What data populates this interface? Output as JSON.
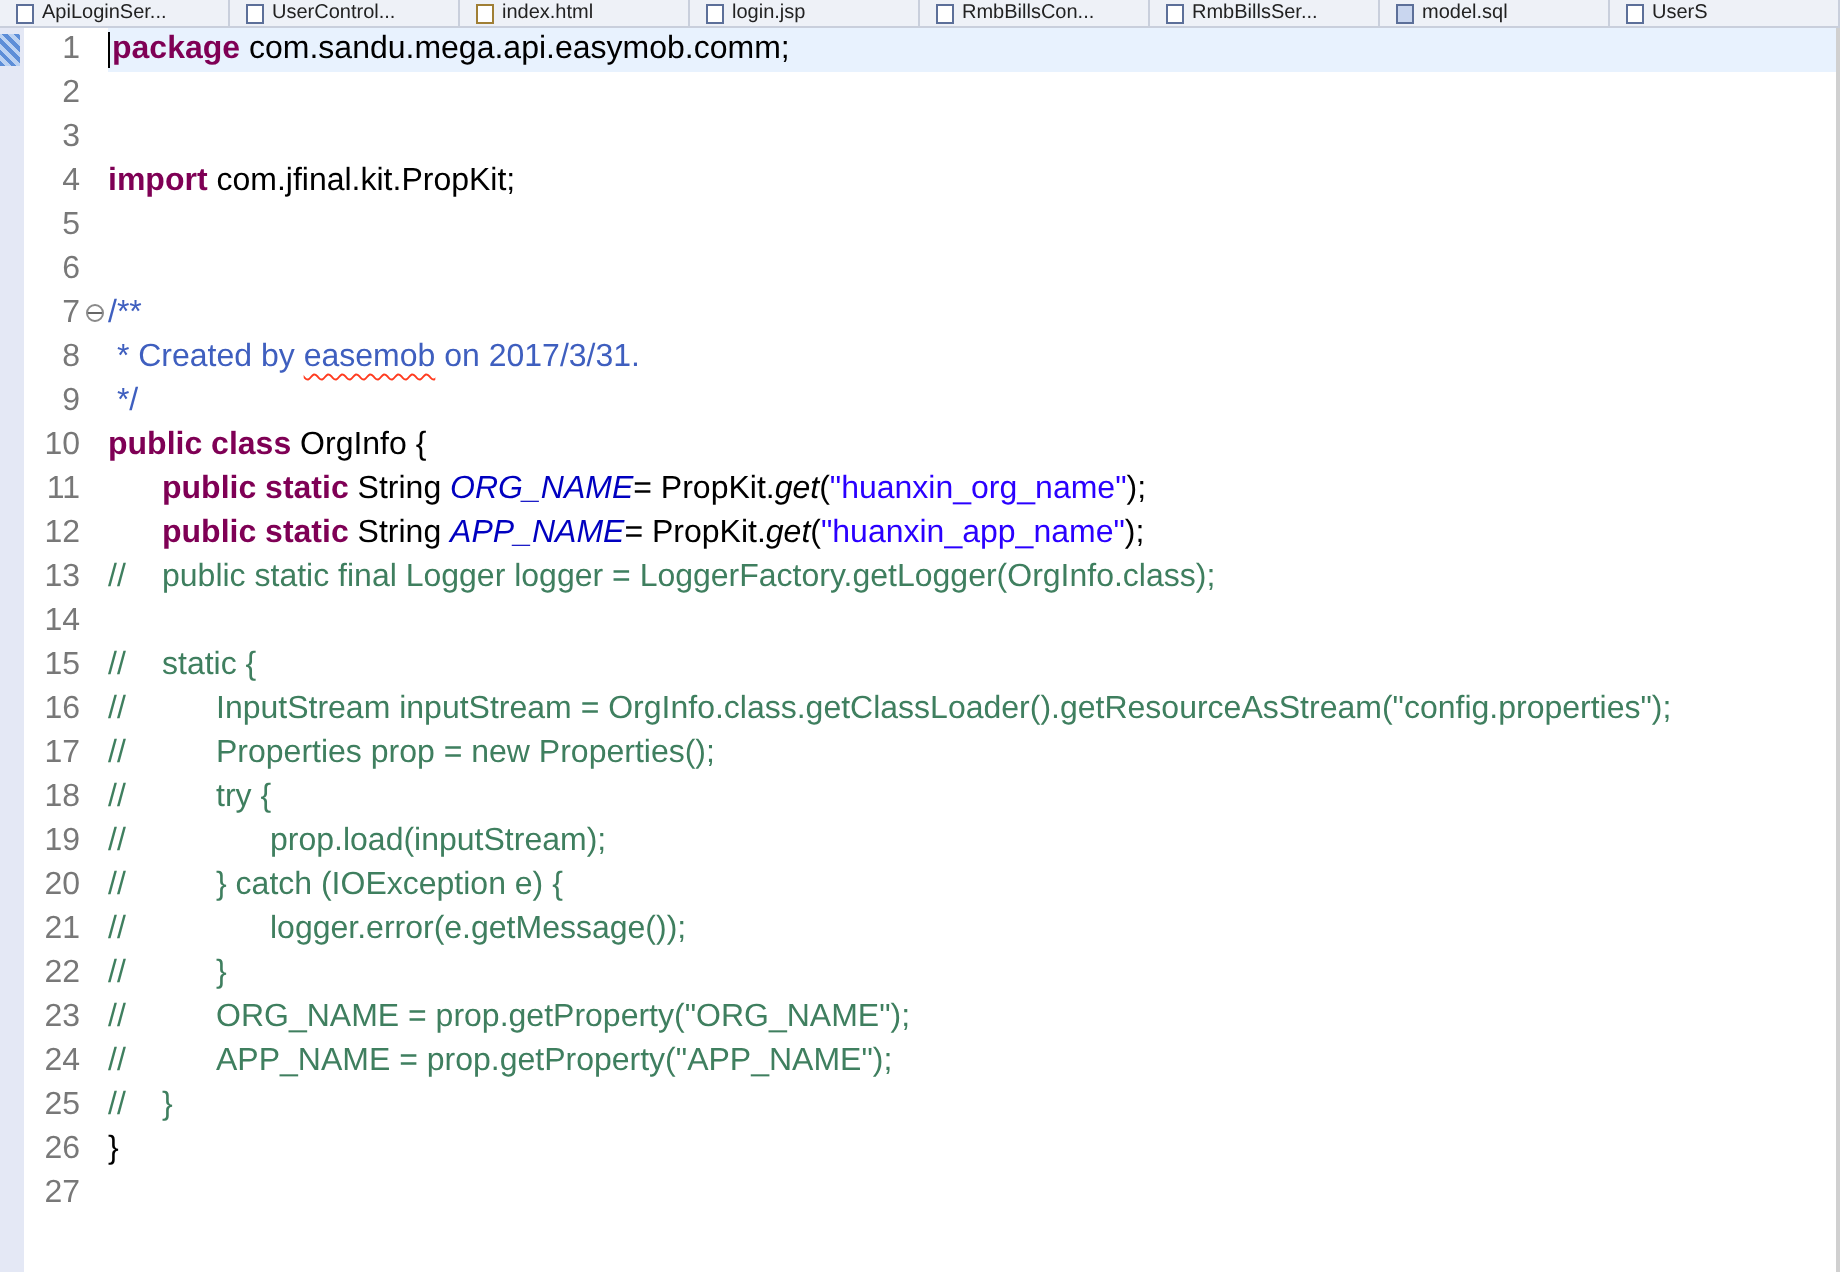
{
  "editor_tabs": [
    {
      "label": "ApiLoginSer...",
      "kind": "java",
      "selected": false
    },
    {
      "label": "UserControl...",
      "kind": "java",
      "selected": false
    },
    {
      "label": "index.html",
      "kind": "html",
      "selected": false
    },
    {
      "label": "login.jsp",
      "kind": "java",
      "selected": false
    },
    {
      "label": "RmbBillsCon...",
      "kind": "java",
      "selected": false
    },
    {
      "label": "RmbBillsSer...",
      "kind": "java",
      "selected": false
    },
    {
      "label": "model.sql",
      "kind": "sql",
      "selected": false
    },
    {
      "label": "UserS",
      "kind": "java",
      "selected": false
    }
  ],
  "lines": [
    {
      "number": "1",
      "current": true,
      "segments": [
        {
          "kind": "keyword",
          "text": "package"
        },
        {
          "kind": "plain",
          "text": " com.sandu.mega.api.easymob.comm;"
        }
      ]
    },
    {
      "number": "2",
      "current": false
    },
    {
      "number": "3",
      "current": false
    },
    {
      "number": "4",
      "current": false,
      "segments": [
        {
          "kind": "keyword",
          "text": "import"
        },
        {
          "kind": "plain",
          "text": " com.jfinal.kit.PropKit;"
        }
      ]
    },
    {
      "number": "5",
      "current": false
    },
    {
      "number": "6",
      "current": false
    },
    {
      "number": "7",
      "current": false,
      "fold_expanded": true,
      "segments": [
        {
          "kind": "javadoc",
          "text": "/**"
        }
      ]
    },
    {
      "number": "8",
      "current": false,
      "segments": [
        {
          "kind": "javadoc",
          "text": " * Created by "
        },
        {
          "kind": "javadoc",
          "text": "easemob",
          "misspelled": true
        },
        {
          "kind": "javadoc",
          "text": " on 2017/3/31."
        }
      ]
    },
    {
      "number": "9",
      "current": false,
      "segments": [
        {
          "kind": "javadoc",
          "text": " */"
        }
      ]
    },
    {
      "number": "10",
      "current": false,
      "segments": [
        {
          "kind": "keyword",
          "text": "public class"
        },
        {
          "kind": "plain",
          "text": " OrgInfo {"
        }
      ]
    },
    {
      "number": "11",
      "current": false,
      "segments": [
        {
          "kind": "keyword",
          "text": "\tpublic static"
        },
        {
          "kind": "plain",
          "text": " String "
        },
        {
          "kind": "field",
          "text": "ORG_NAME"
        },
        {
          "kind": "plain",
          "text": "= PropKit."
        },
        {
          "kind": "method",
          "text": "get"
        },
        {
          "kind": "plain",
          "text": "("
        },
        {
          "kind": "string",
          "text": "\"huanxin_org_name\""
        },
        {
          "kind": "plain",
          "text": ");"
        }
      ]
    },
    {
      "number": "12",
      "current": false,
      "segments": [
        {
          "kind": "keyword",
          "text": "\tpublic static"
        },
        {
          "kind": "plain",
          "text": " String "
        },
        {
          "kind": "field",
          "text": "APP_NAME"
        },
        {
          "kind": "plain",
          "text": "= PropKit."
        },
        {
          "kind": "method",
          "text": "get"
        },
        {
          "kind": "plain",
          "text": "("
        },
        {
          "kind": "string",
          "text": "\"huanxin_app_name\""
        },
        {
          "kind": "plain",
          "text": ");"
        }
      ]
    },
    {
      "number": "13",
      "current": false,
      "segments": [
        {
          "kind": "comment",
          "text": "//\tpublic static final Logger logger = LoggerFactory.getLogger(OrgInfo.class);"
        }
      ]
    },
    {
      "number": "14",
      "current": false
    },
    {
      "number": "15",
      "current": false,
      "segments": [
        {
          "kind": "comment",
          "text": "//\tstatic {"
        }
      ]
    },
    {
      "number": "16",
      "current": false,
      "segments": [
        {
          "kind": "comment",
          "text": "//\t\tInputStream inputStream = OrgInfo.class.getClassLoader().getResourceAsStream(\"config.properties\");"
        }
      ]
    },
    {
      "number": "17",
      "current": false,
      "segments": [
        {
          "kind": "comment",
          "text": "//\t\tProperties prop = new Properties();"
        }
      ]
    },
    {
      "number": "18",
      "current": false,
      "segments": [
        {
          "kind": "comment",
          "text": "//\t\ttry {"
        }
      ]
    },
    {
      "number": "19",
      "current": false,
      "segments": [
        {
          "kind": "comment",
          "text": "//\t\t\tprop.load(inputStream);"
        }
      ]
    },
    {
      "number": "20",
      "current": false,
      "segments": [
        {
          "kind": "comment",
          "text": "//\t\t} catch (IOException e) {"
        }
      ]
    },
    {
      "number": "21",
      "current": false,
      "segments": [
        {
          "kind": "comment",
          "text": "//\t\t\tlogger.error(e.getMessage());"
        }
      ]
    },
    {
      "number": "22",
      "current": false,
      "segments": [
        {
          "kind": "comment",
          "text": "//\t\t}"
        }
      ]
    },
    {
      "number": "23",
      "current": false,
      "segments": [
        {
          "kind": "comment",
          "text": "//\t\tORG_NAME = prop.getProperty(\"ORG_NAME\");"
        }
      ]
    },
    {
      "number": "24",
      "current": false,
      "segments": [
        {
          "kind": "comment",
          "text": "//\t\tAPP_NAME = prop.getProperty(\"APP_NAME\");"
        }
      ]
    },
    {
      "number": "25",
      "current": false,
      "segments": [
        {
          "kind": "comment",
          "text": "//\t}"
        }
      ]
    },
    {
      "number": "26",
      "current": false,
      "segments": [
        {
          "kind": "plain",
          "text": "}"
        }
      ]
    },
    {
      "number": "27",
      "current": false
    }
  ]
}
